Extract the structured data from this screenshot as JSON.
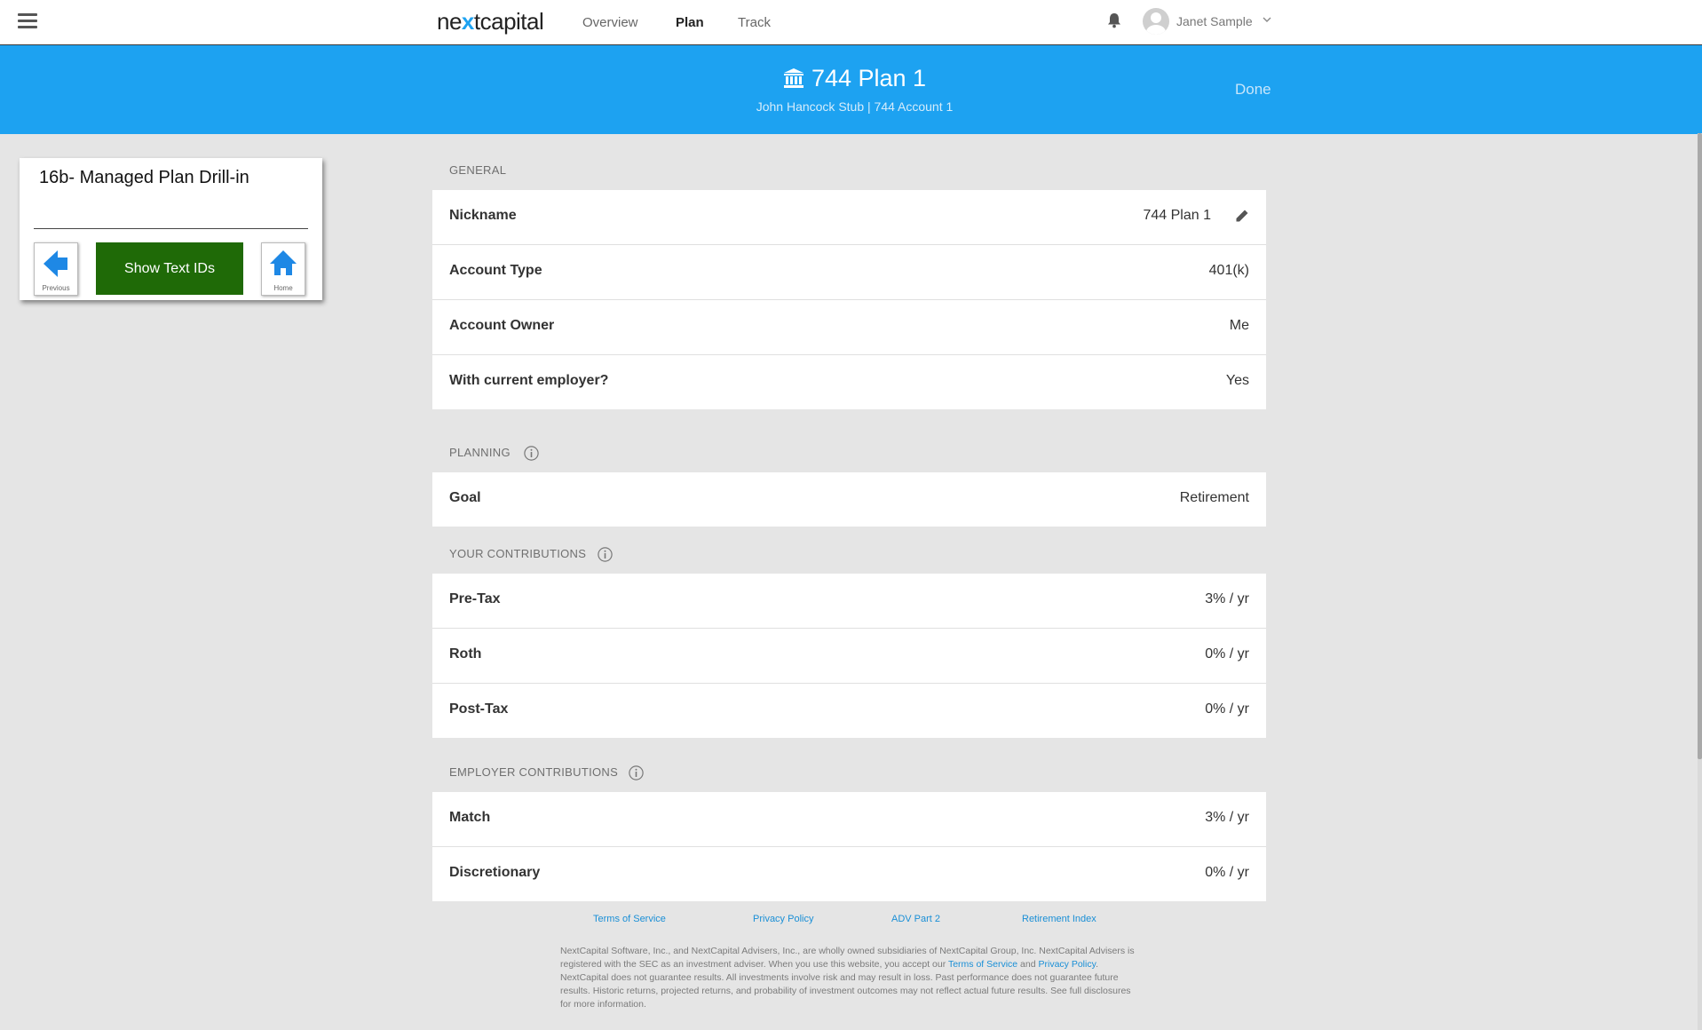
{
  "nav": {
    "brand_before": "ne",
    "brand_x": "x",
    "brand_after": "tcapital",
    "links": [
      "Overview",
      "Plan",
      "Track"
    ],
    "active": "Plan",
    "user_name": "Janet Sample",
    "icons": [
      "menu-icon",
      "bell-icon",
      "user-avatar-icon",
      "chevron-down-icon"
    ]
  },
  "header": {
    "title": "744 Plan 1",
    "subtitle": "John Hancock Stub | 744 Account 1",
    "done_label": "Done",
    "icon": "bank-icon"
  },
  "widget": {
    "title": "16b- Managed Plan Drill-in",
    "previous_label": "Previous",
    "show_text_ids_label": "Show Text IDs",
    "home_label": "Home",
    "show_button_color": "#1f6a07"
  },
  "sections": {
    "general": {
      "label": "GENERAL",
      "rows": [
        {
          "label": "Nickname",
          "value": "744 Plan 1"
        },
        {
          "label": "Account Type",
          "value": "401(k)"
        },
        {
          "label": "Account Owner",
          "value": "Me"
        },
        {
          "label": "With current employer?",
          "value": "Yes"
        }
      ]
    },
    "planning": {
      "label": "PLANNING",
      "rows": [
        {
          "label": "Goal",
          "value": "Retirement"
        }
      ]
    },
    "your_contributions": {
      "label": "YOUR CONTRIBUTIONS",
      "rows": [
        {
          "label": "Pre-Tax",
          "value": "3% / yr"
        },
        {
          "label": "Roth",
          "value": "0% / yr"
        },
        {
          "label": "Post-Tax",
          "value": "0% / yr"
        }
      ]
    },
    "employer_contributions": {
      "label": "EMPLOYER CONTRIBUTIONS",
      "rows": [
        {
          "label": "Match",
          "value": "3% / yr"
        },
        {
          "label": "Discretionary",
          "value": "0% / yr"
        }
      ]
    }
  },
  "footer": {
    "links": [
      "Terms of Service",
      "Privacy Policy",
      "ADV Part 2",
      "Retirement Index"
    ],
    "disclaimer_1": "NextCapital Software, Inc., and NextCapital Advisers, Inc., are wholly owned subsidiaries of NextCapital Group, Inc. NextCapital Advisers is registered with the SEC as an investment adviser. When you use this website, you accept our ",
    "disclaimer_link_1": "Terms of Service",
    "disclaimer_2": " and ",
    "disclaimer_link_2": "Privacy Policy",
    "disclaimer_3": ". NextCapital does not guarantee results. All investments involve risk and may result in loss. Past performance does not guarantee future results. Historic returns, projected returns, and probability of investment outcomes may not reflect actual future results. See full disclosures for more information."
  },
  "colors": {
    "accent": "#1da2f1",
    "background": "#e5e5e5",
    "link": "#1a8fd6"
  }
}
